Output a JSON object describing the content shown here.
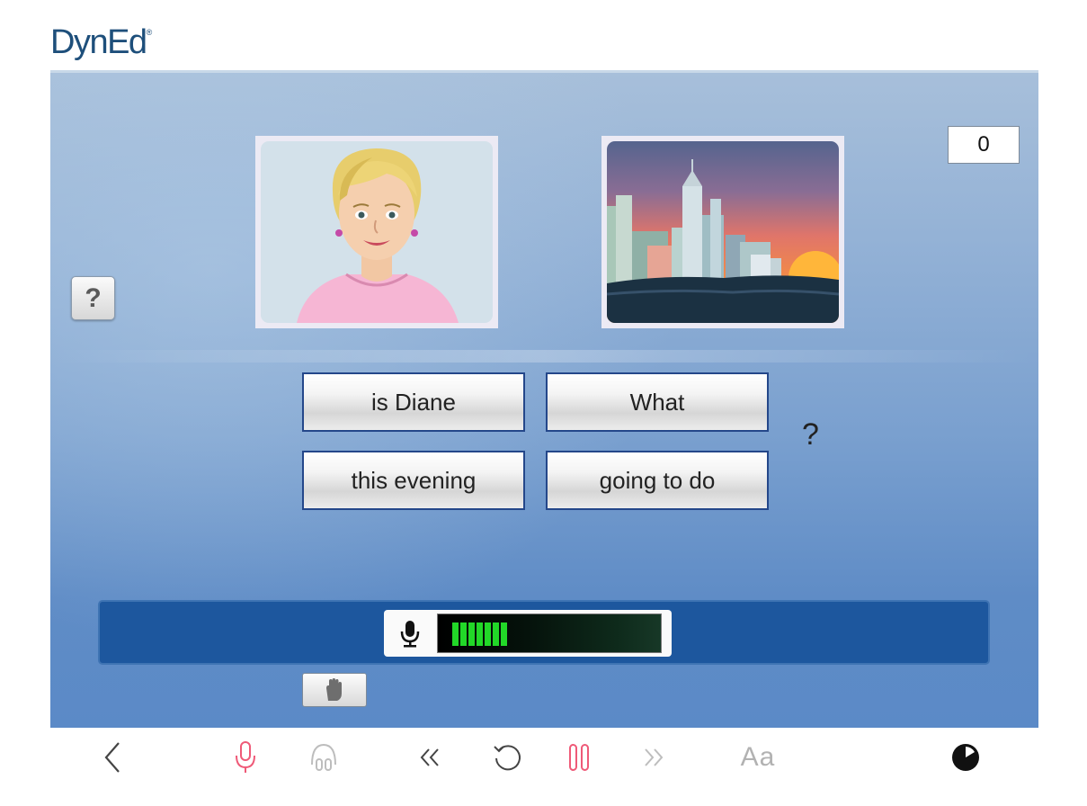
{
  "header": {
    "logo_text": "DynEd",
    "logo_mark": "®"
  },
  "score": {
    "value": "0"
  },
  "help": {
    "label": "?"
  },
  "pictures": [
    {
      "name": "woman-portrait"
    },
    {
      "name": "city-sunset"
    }
  ],
  "words": {
    "button1": "is Diane",
    "button2": "What",
    "button3": "this evening",
    "button4": "going to do",
    "question_mark": "?"
  },
  "recorder": {
    "level": 0.3
  },
  "toolbar": {
    "items": [
      "back-icon",
      "microphone-icon",
      "headphones-icon",
      "rewind-icon",
      "replay-icon",
      "pause-icon",
      "fast-forward-icon",
      "text-toggle",
      "timer-icon"
    ],
    "text_toggle_label": "Aa"
  },
  "colors": {
    "brand": "#1e4f7b",
    "accent_pink": "#ef5a78",
    "stage_blue": "#7aa0cf",
    "record_bar": "#1d579e",
    "meter_green": "#22d828",
    "button_border": "#24478a"
  }
}
